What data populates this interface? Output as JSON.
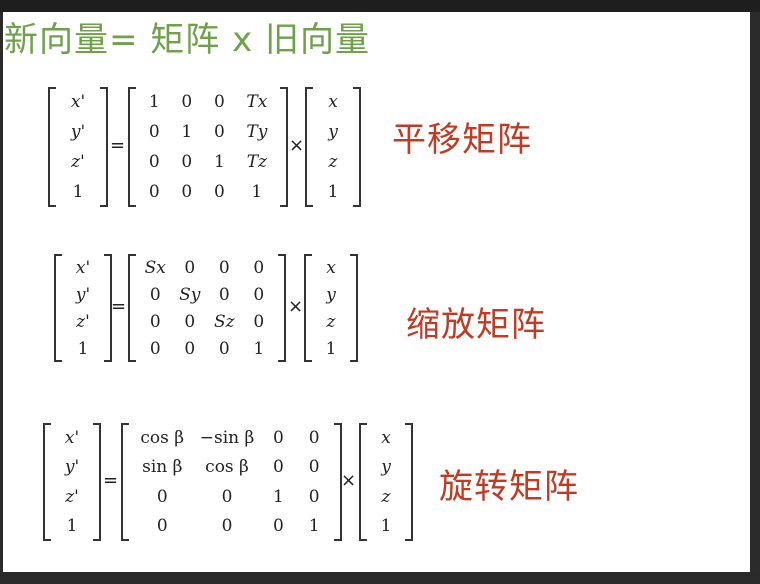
{
  "headline": "新向量= 矩阵 x 旧向量",
  "equations": [
    {
      "label": "平移矩阵",
      "lhs": [
        "x'",
        "y'",
        "z'",
        "1"
      ],
      "matrix": [
        [
          "1",
          "0",
          "0",
          "Tx"
        ],
        [
          "0",
          "1",
          "0",
          "Ty"
        ],
        [
          "0",
          "0",
          "1",
          "Tz"
        ],
        [
          "0",
          "0",
          "0",
          "1"
        ]
      ],
      "rhs": [
        "x",
        "y",
        "z",
        "1"
      ],
      "equals": "=",
      "times": "×"
    },
    {
      "label": "缩放矩阵",
      "lhs": [
        "x'",
        "y'",
        "z'",
        "1"
      ],
      "matrix": [
        [
          "Sx",
          "0",
          "0",
          "0"
        ],
        [
          "0",
          "Sy",
          "0",
          "0"
        ],
        [
          "0",
          "0",
          "Sz",
          "0"
        ],
        [
          "0",
          "0",
          "0",
          "1"
        ]
      ],
      "rhs": [
        "x",
        "y",
        "z",
        "1"
      ],
      "equals": "=",
      "times": "×"
    },
    {
      "label": "旋转矩阵",
      "lhs": [
        "x'",
        "y'",
        "z'",
        "1"
      ],
      "matrix": [
        [
          "cos β",
          "−sin β",
          "0",
          "0"
        ],
        [
          "sin β",
          "cos β",
          "0",
          "0"
        ],
        [
          "0",
          "0",
          "1",
          "0"
        ],
        [
          "0",
          "0",
          "0",
          "1"
        ]
      ],
      "rhs": [
        "x",
        "y",
        "z",
        "1"
      ],
      "equals": "=",
      "times": "×"
    }
  ]
}
